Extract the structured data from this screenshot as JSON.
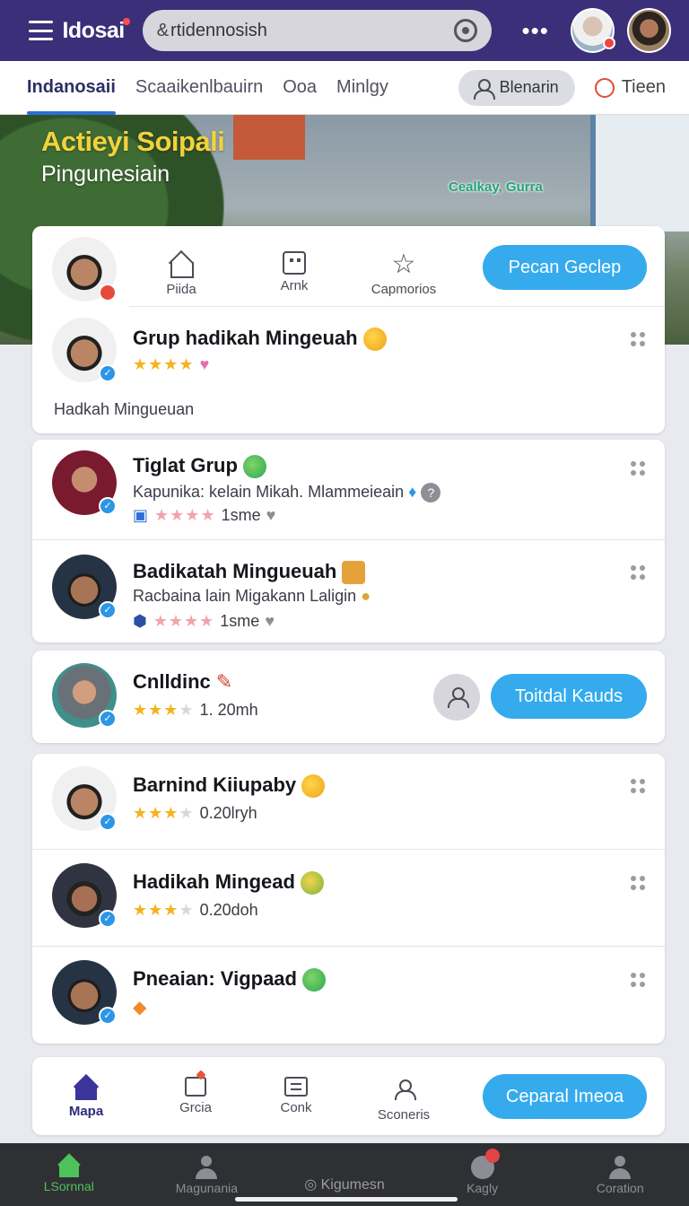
{
  "topbar": {
    "brand": "Idosai",
    "search_prefix": "&",
    "search_value": "rtidennosish",
    "more": "•••"
  },
  "tabs": {
    "items": [
      "Indanosaii",
      "Scaaikenlbauirn",
      "Ooa",
      "Minlgy"
    ],
    "filter_button": "Blenarin",
    "time_tab": "Tieen"
  },
  "hero": {
    "title": "Actieyi Soipali",
    "subtitle": "Pingunesiain",
    "tag": "Cealkay, Gurra"
  },
  "profile_card": {
    "nav": [
      "Piida",
      "Arnk",
      "Capmorios"
    ],
    "action_button": "Pecan Geclep"
  },
  "items": [
    {
      "name": "Grup hadikah Mingeuah",
      "stars": "★★★★",
      "extra": "♥",
      "note": "Hadkah Mingueuan"
    },
    {
      "name": "Tiglat Grup",
      "sub": "Kapunika: kelain Mikah. Mlammeieain",
      "stars": "★★★★",
      "count": "1sme"
    },
    {
      "name": "Badikatah Mingueuah",
      "sub": "Racbaina lain Migakann Laligin",
      "stars": "★★★★",
      "count": "1sme"
    },
    {
      "name": "Cnlldinc",
      "stars_on": "★★★",
      "stars_off": "★",
      "count": "1. 20mh",
      "button": "Toitdal Kauds"
    },
    {
      "name": "Barnind Kiiupaby",
      "stars_on": "★★★",
      "stars_off": "★",
      "count": "0.20lryh"
    },
    {
      "name": "Hadikah Mingead",
      "stars_on": "★★★",
      "stars_off": "★",
      "count": "0.20doh"
    },
    {
      "name": "Pneaian: Vigpaad"
    }
  ],
  "toolbar": {
    "items": [
      "Mapa",
      "Grcia",
      "Conk",
      "Sconeris"
    ],
    "button": "Ceparal Imeoa"
  },
  "sysnav": {
    "items": [
      "LSornnal",
      "Magunania",
      "◎ Kigumesn",
      "Kagly",
      "Coration"
    ]
  },
  "colors": {
    "topbar": "#3a2f78",
    "accent": "#35abed",
    "star": "#f5b21c",
    "active_green": "#4fc15a"
  }
}
